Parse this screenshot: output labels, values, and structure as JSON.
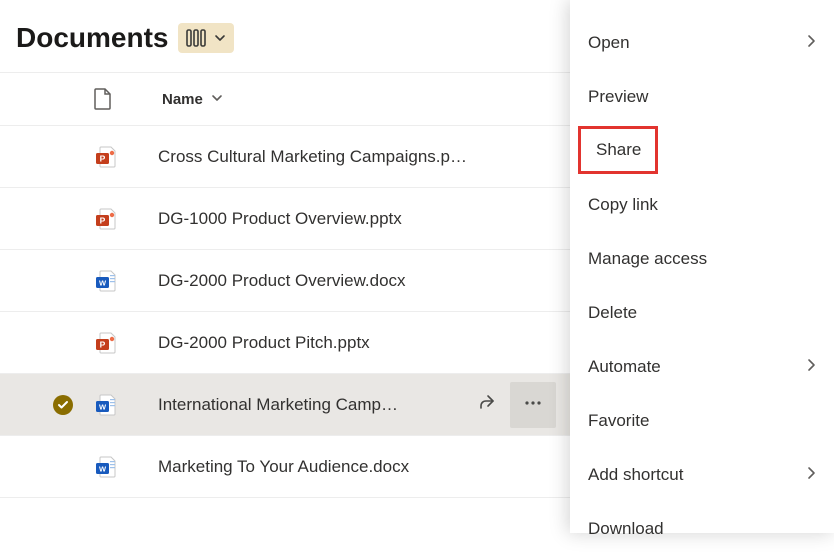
{
  "header": {
    "title": "Documents"
  },
  "columns": {
    "name_label": "Name"
  },
  "files": [
    {
      "name": "Cross Cultural Marketing Campaigns.pptx",
      "icon": "pptx",
      "selected": false
    },
    {
      "name": "DG-1000 Product Overview.pptx",
      "icon": "pptx",
      "selected": false
    },
    {
      "name": "DG-2000 Product Overview.docx",
      "icon": "docx",
      "selected": false
    },
    {
      "name": "DG-2000 Product Pitch.pptx",
      "icon": "pptx",
      "selected": false
    },
    {
      "name": "International Marketing Camp…",
      "icon": "docx",
      "selected": true
    },
    {
      "name": "Marketing To Your Audience.docx",
      "icon": "docx",
      "selected": false
    }
  ],
  "context_menu": {
    "open": "Open",
    "preview": "Preview",
    "share": "Share",
    "copy_link": "Copy link",
    "manage_access": "Manage access",
    "delete": "Delete",
    "automate": "Automate",
    "favorite": "Favorite",
    "add_shortcut": "Add shortcut",
    "download": "Download"
  },
  "colors": {
    "highlight_border": "#e2342f",
    "selected_row_bg": "#e9e7e4",
    "selected_check": "#8a6d00"
  }
}
